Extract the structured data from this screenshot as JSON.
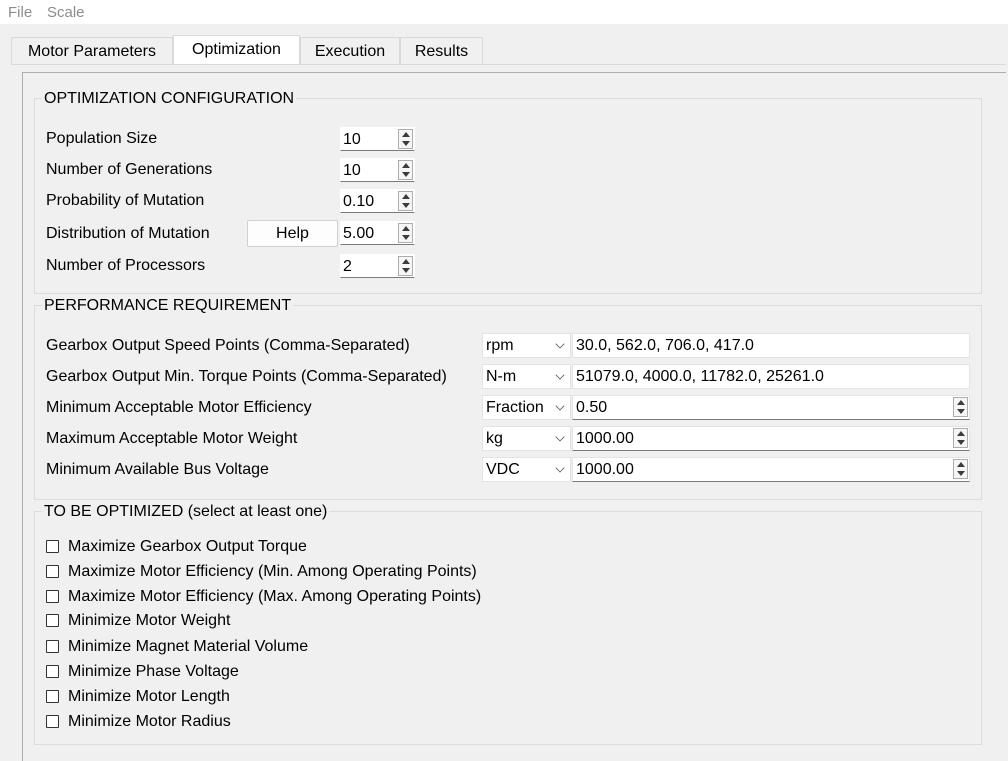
{
  "menu": {
    "file": "File",
    "scale": "Scale"
  },
  "tabs": [
    "Motor Parameters",
    "Optimization",
    "Execution",
    "Results"
  ],
  "optimization_config": {
    "title": "OPTIMIZATION CONFIGURATION",
    "population_size": {
      "label": "Population Size",
      "value": "10"
    },
    "generations": {
      "label": "Number of Generations",
      "value": "10"
    },
    "prob_mutation": {
      "label": "Probability of Mutation",
      "value": "0.10"
    },
    "dist_mutation": {
      "label": "Distribution of Mutation",
      "value": "5.00",
      "help": "Help"
    },
    "processors": {
      "label": "Number of Processors",
      "value": "2"
    }
  },
  "performance": {
    "title": "PERFORMANCE REQUIREMENT",
    "speed": {
      "label": "Gearbox Output Speed Points (Comma-Separated)",
      "unit": "rpm",
      "value": "30.0, 562.0, 706.0, 417.0"
    },
    "torque": {
      "label": "Gearbox Output Min. Torque Points (Comma-Separated)",
      "unit": "N-m",
      "value": "51079.0, 4000.0, 11782.0, 25261.0"
    },
    "efficiency": {
      "label": "Minimum Acceptable Motor Efficiency",
      "unit": "Fraction",
      "value": "0.50"
    },
    "weight": {
      "label": "Maximum Acceptable Motor Weight",
      "unit": "kg",
      "value": "1000.00"
    },
    "voltage": {
      "label": "Minimum Available Bus Voltage",
      "unit": "VDC",
      "value": "1000.00"
    }
  },
  "to_optimize": {
    "title": "TO BE OPTIMIZED (select at least one)",
    "items": [
      "Maximize Gearbox Output Torque",
      "Maximize Motor Efficiency (Min. Among Operating Points)",
      "Maximize Motor Efficiency (Max. Among Operating Points)",
      "Minimize Motor Weight",
      "Minimize Magnet Material Volume",
      "Minimize Phase Voltage",
      "Minimize Motor Length",
      "Minimize Motor Radius"
    ]
  }
}
